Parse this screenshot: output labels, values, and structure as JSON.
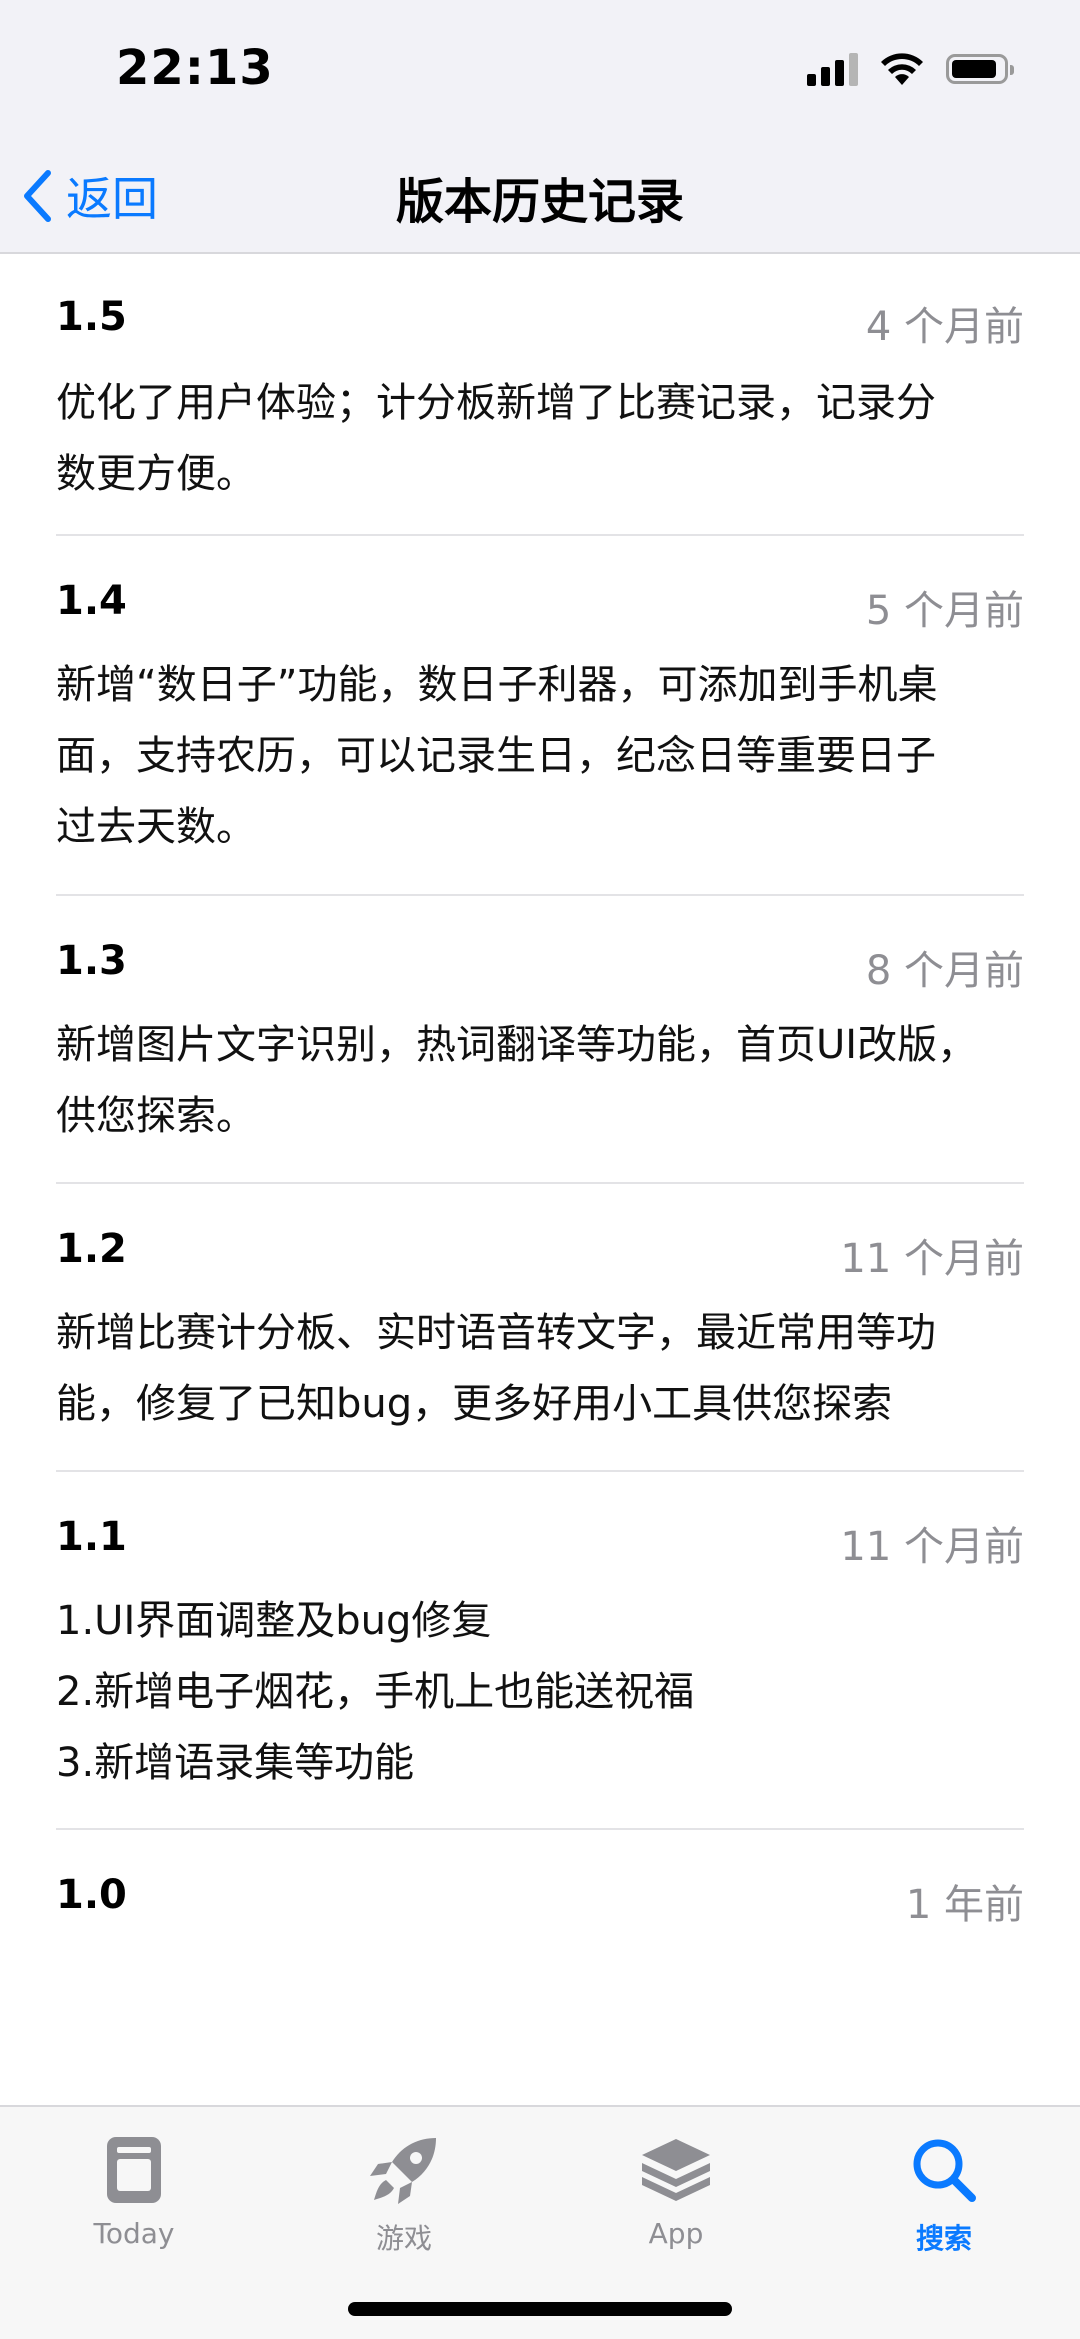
{
  "status_bar": {
    "time": "22:13"
  },
  "nav": {
    "back_label": "返回",
    "title": "版本历史记录"
  },
  "versions": [
    {
      "version": "1.5",
      "date": "4 个月前",
      "notes": "优化了用户体验；计分板新增了比赛记录，记录分\n数更方便。"
    },
    {
      "version": "1.4",
      "date": "5 个月前",
      "notes": "新增“数日子”功能，数日子利器，可添加到手机桌\n面，支持农历，可以记录生日，纪念日等重要日子\n过去天数。"
    },
    {
      "version": "1.3",
      "date": "8 个月前",
      "notes": "新增图片文字识别，热词翻译等功能，首页UI改版，\n供您探索。"
    },
    {
      "version": "1.2",
      "date": "11 个月前",
      "notes": "新增比赛计分板、实时语音转文字，最近常用等功\n能，修复了已知bug，更多好用小工具供您探索"
    },
    {
      "version": "1.1",
      "date": "11 个月前",
      "notes": "1.UI界面调整及bug修复\n2.新增电子烟花，手机上也能送祝福\n3.新增语录集等功能"
    },
    {
      "version": "1.0",
      "date": "1 年前",
      "notes": ""
    }
  ],
  "tab_bar": {
    "tabs": [
      {
        "label": "Today",
        "icon": "today-icon",
        "active": false
      },
      {
        "label": "游戏",
        "icon": "rocket-icon",
        "active": false
      },
      {
        "label": "App",
        "icon": "app-stack-icon",
        "active": false
      },
      {
        "label": "搜索",
        "icon": "search-icon",
        "active": true
      }
    ]
  },
  "colors": {
    "accent": "#0a7aff",
    "secondary_text": "#8e8e93"
  }
}
